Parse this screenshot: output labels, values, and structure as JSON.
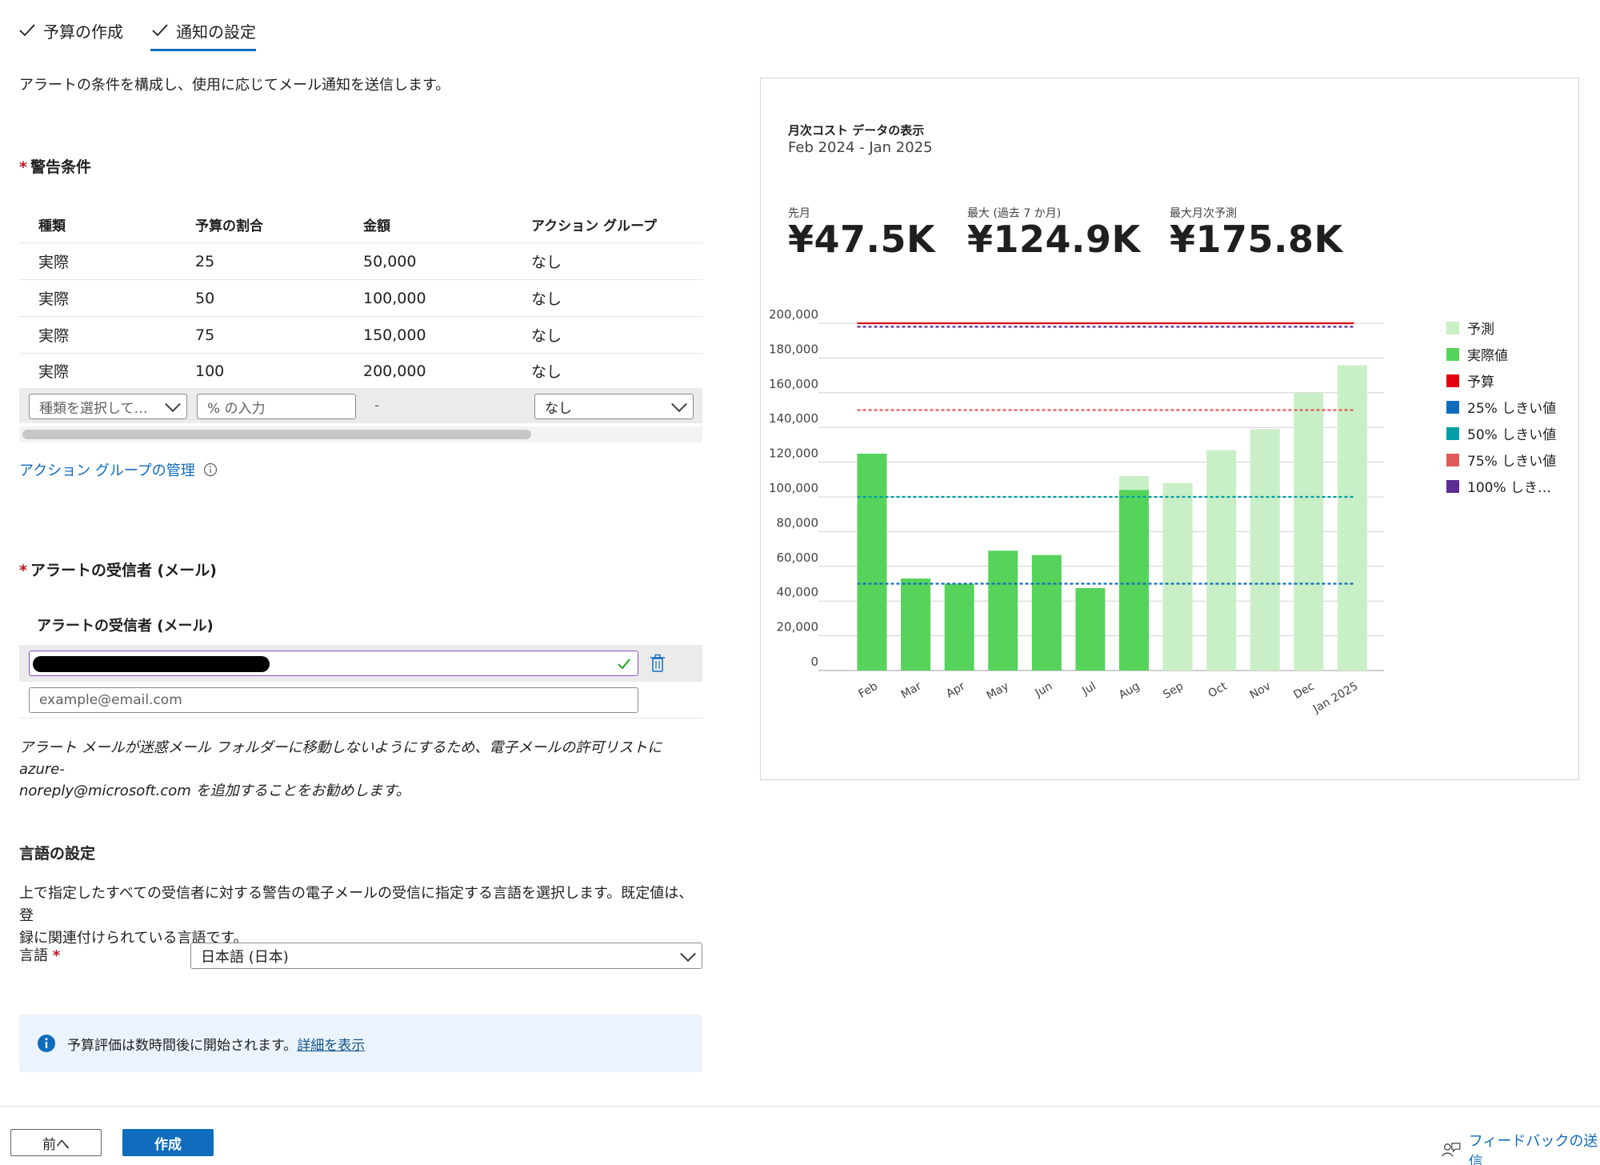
{
  "tabs": [
    {
      "label": "予算の作成",
      "active": false
    },
    {
      "label": "通知の設定",
      "active": true
    }
  ],
  "intro": "アラートの条件を構成し、使用に応じてメール通知を送信します。",
  "alert_conditions": {
    "title": "警告条件",
    "headers": [
      "種類",
      "予算の割合",
      "金額",
      "アクション グループ"
    ],
    "rows": [
      {
        "type": "実際",
        "percent": "25",
        "amount": "50,000",
        "action_group": "なし"
      },
      {
        "type": "実際",
        "percent": "50",
        "amount": "100,000",
        "action_group": "なし"
      },
      {
        "type": "実際",
        "percent": "75",
        "amount": "150,000",
        "action_group": "なし"
      },
      {
        "type": "実際",
        "percent": "100",
        "amount": "200,000",
        "action_group": "なし"
      }
    ],
    "new_row": {
      "type_placeholder": "種類を選択して…",
      "percent_placeholder": "% の入力",
      "amount": "-",
      "action_group": "なし"
    },
    "manage_link": "アクション グループの管理"
  },
  "recipients": {
    "title": "アラートの受信者 (メール)",
    "column_header": "アラートの受信者 (メール)",
    "placeholder": "example@email.com",
    "note": "アラート メールが迷惑メール フォルダーに移動しないようにするため、電子メールの許可リストに azure-noreply@microsoft.com を追加することをお勧めします。",
    "note_line1": "アラート メールが迷惑メール フォルダーに移動しないようにするため、電子メールの許可リストに azure-",
    "note_line2": "noreply@microsoft.com を追加することをお勧めします。"
  },
  "language": {
    "title": "言語の設定",
    "description_line1": "上で指定したすべての受信者に対する警告の電子メールの受信に指定する言語を選択します。既定値は、登",
    "description_line2": "録に関連付けられている言語です。",
    "label": "言語",
    "value": "日本語 (日本)"
  },
  "info_bar": {
    "text": "予算評価は数時間後に開始されます。",
    "link": "詳細を表示"
  },
  "footer": {
    "prev_label": "前へ",
    "create_label": "作成",
    "feedback_label": "フィードバックの送信"
  },
  "chart_panel": {
    "title": "月次コスト データの表示",
    "range": "Feb 2024 - Jan 2025",
    "kpis": [
      {
        "label": "先月",
        "value": "¥47.5K"
      },
      {
        "label": "最大 (過去 7 か月)",
        "value": "¥124.9K"
      },
      {
        "label": "最大月次予測",
        "value": "¥175.8K"
      }
    ]
  },
  "chart_data": {
    "type": "bar",
    "categories": [
      "Feb",
      "Mar",
      "Apr",
      "May",
      "Jun",
      "Jul",
      "Aug",
      "Sep",
      "Oct",
      "Nov",
      "Dec",
      "Jan 2025"
    ],
    "series": [
      {
        "name": "予測",
        "values": [
          null,
          null,
          null,
          null,
          null,
          null,
          112000,
          108000,
          127000,
          139000,
          160000,
          175800
        ]
      },
      {
        "name": "実際値",
        "values": [
          124900,
          53000,
          50000,
          69000,
          66500,
          47500,
          104000,
          null,
          null,
          null,
          null,
          null
        ]
      }
    ],
    "reference_lines": [
      {
        "name": "予算",
        "value": 200000,
        "color": "#e0000f",
        "style": "solid"
      },
      {
        "name": "25% しきい値",
        "value": 50000,
        "color": "#0f6cbd",
        "style": "dotted"
      },
      {
        "name": "50% しきい値",
        "value": 100000,
        "color": "#009ea5",
        "style": "dotted"
      },
      {
        "name": "75% しきい値",
        "value": 150000,
        "color": "#e05a5a",
        "style": "dotted"
      },
      {
        "name": "100% しき…",
        "value": 198000,
        "color": "#5c2d91",
        "style": "dotted"
      }
    ],
    "legend": [
      {
        "label": "予測",
        "color": "#c9efc6"
      },
      {
        "label": "実際値",
        "color": "#56d35a"
      },
      {
        "label": "予算",
        "color": "#e0000f"
      },
      {
        "label": "25% しきい値",
        "color": "#0f6cbd"
      },
      {
        "label": "50% しきい値",
        "color": "#009ea5"
      },
      {
        "label": "75% しきい値",
        "color": "#e05a5a"
      },
      {
        "label": "100% しき…",
        "color": "#5c2d91"
      }
    ],
    "yticks": [
      "0",
      "20,000",
      "40,000",
      "60,000",
      "80,000",
      "100,000",
      "120,000",
      "140,000",
      "160,000",
      "180,000",
      "200,000"
    ],
    "ylim": [
      0,
      200000
    ],
    "legend_position": "right",
    "grid": true
  },
  "colors": {
    "accent": "#0f6cbd",
    "actual": "#56d35a",
    "forecast": "#c9efc6",
    "required": "#c50f1f"
  }
}
